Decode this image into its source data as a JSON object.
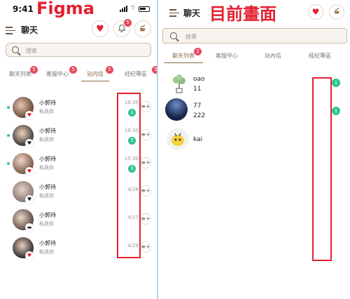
{
  "figma": {
    "status_time": "9:41",
    "label": "Figma",
    "title": "聊天",
    "heart_glyph": "♥",
    "bell_badge": "5",
    "search_placeholder": "搜索",
    "tabs": [
      {
        "label": "聊天列表",
        "badge": "5"
      },
      {
        "label": "客服中心",
        "badge": "5"
      },
      {
        "label": "站内信",
        "badge": "5",
        "active": true
      },
      {
        "label": "经纪專區",
        "badge": "5"
      }
    ],
    "chats": [
      {
        "name": "小郭待",
        "message": "私訊你",
        "time": "18:30",
        "count": "1",
        "online": true,
        "heart": "♥"
      },
      {
        "name": "小郭待",
        "message": "私訊你",
        "time": "16:30",
        "count": "5",
        "online": true,
        "heart": "♥"
      },
      {
        "name": "小郭待",
        "message": "私訊你",
        "time": "15:30",
        "count": "3",
        "online": true,
        "heart": "♥"
      },
      {
        "name": "小郭待",
        "message": "私訊你",
        "time": "4/26",
        "count": "",
        "online": false,
        "heart": "♥"
      },
      {
        "name": "小郭待",
        "message": "私訊你",
        "time": "4/27",
        "count": "",
        "online": false,
        "heart": "▬"
      },
      {
        "name": "小郭待",
        "message": "私訊你",
        "time": "4/28",
        "count": "",
        "online": false,
        "heart": "♥"
      }
    ],
    "colors": {
      "accent": "#8a6d4a",
      "badge": "#e8495d",
      "count": "#2fc48d",
      "highlight": "#e4202f"
    }
  },
  "current": {
    "title": "聊天",
    "label": "目前畫面",
    "search_placeholder": "搜尋",
    "tabs": [
      {
        "label": "聊天列表",
        "badge": "2",
        "active": true
      },
      {
        "label": "客服中心"
      },
      {
        "label": "站內信"
      },
      {
        "label": "經紀專區"
      }
    ],
    "chats": [
      {
        "line1": "oao",
        "line2": "11",
        "count": "1"
      },
      {
        "line1": "77",
        "line2": "222",
        "count": "1"
      },
      {
        "line1": "kai",
        "line2": "",
        "count": ""
      }
    ]
  }
}
